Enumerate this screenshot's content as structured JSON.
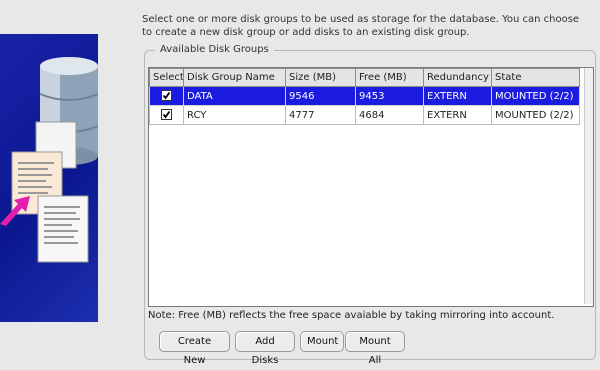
{
  "instructions": "Select one or more disk groups to be used as storage for the database. You can choose to create a new disk group or add disks to an existing disk group.",
  "group_title": "Available Disk Groups",
  "table": {
    "columns": [
      "Select",
      "Disk Group Name",
      "Size (MB)",
      "Free (MB)",
      "Redundancy",
      "State"
    ],
    "rows": [
      {
        "selected": true,
        "checked": true,
        "name": "DATA",
        "size": "9546",
        "free": "9453",
        "redundancy": "EXTERN",
        "state": "MOUNTED (2/2)"
      },
      {
        "selected": false,
        "checked": true,
        "name": "RCY",
        "size": "4777",
        "free": "4684",
        "redundancy": "EXTERN",
        "state": "MOUNTED (2/2)"
      }
    ]
  },
  "note": "Note: Free (MB) reflects the free space avaiable by taking mirroring into account.",
  "buttons": {
    "create_new": "Create New",
    "add_disks": "Add Disks",
    "mount": "Mount",
    "mount_all": "Mount All"
  },
  "colors": {
    "selection": "#1c1ce0",
    "panel_blue": "#0b1890"
  },
  "icons": [
    "database-cylinder-icon",
    "documents-icon",
    "arrow-icon"
  ]
}
